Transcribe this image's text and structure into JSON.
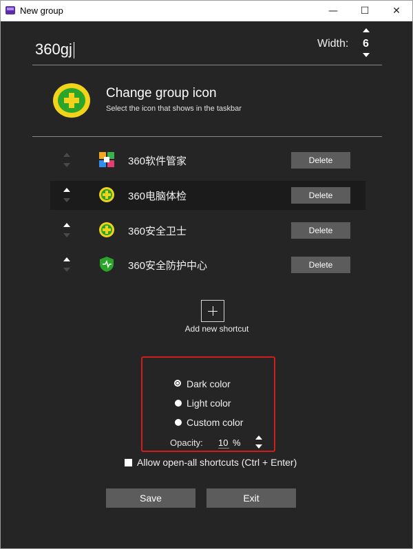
{
  "window": {
    "title": "New group",
    "controls": {
      "minimize": "—",
      "maximize": "☐",
      "close": "✕"
    }
  },
  "group": {
    "name_value": "360gj",
    "width_label": "Width:",
    "width_value": "6"
  },
  "icon_section": {
    "title": "Change group icon",
    "subtitle": "Select the icon that shows in the taskbar",
    "icon": "360-safeguard-icon"
  },
  "shortcuts": [
    {
      "label": "360软件管家",
      "icon": "360-software-manager-icon",
      "delete_label": "Delete",
      "can_move_up": false,
      "can_move_down": false
    },
    {
      "label": "360电脑体检",
      "icon": "360-checkup-icon",
      "delete_label": "Delete",
      "can_move_up": true,
      "can_move_down": false
    },
    {
      "label": "360安全卫士",
      "icon": "360-safeguard-icon",
      "delete_label": "Delete",
      "can_move_up": true,
      "can_move_down": false
    },
    {
      "label": "360安全防护中心",
      "icon": "360-shield-icon",
      "delete_label": "Delete",
      "can_move_up": true,
      "can_move_down": false
    }
  ],
  "add_shortcut": {
    "label": "Add new shortcut"
  },
  "color_options": {
    "items": [
      {
        "label": "Dark color",
        "checked": true
      },
      {
        "label": "Light color",
        "checked": false
      },
      {
        "label": "Custom color",
        "checked": false
      }
    ],
    "opacity_label": "Opacity:",
    "opacity_value": "10",
    "opacity_unit": "%"
  },
  "open_all": {
    "label": "Allow open-all shortcuts (Ctrl + Enter)",
    "checked": false
  },
  "buttons": {
    "save": "Save",
    "exit": "Exit"
  },
  "colors": {
    "background": "#252525",
    "button": "#5c5c5c",
    "highlight_box": "#d21d1d",
    "accent_green": "#2aa52a",
    "accent_yellow": "#f2d21b"
  }
}
